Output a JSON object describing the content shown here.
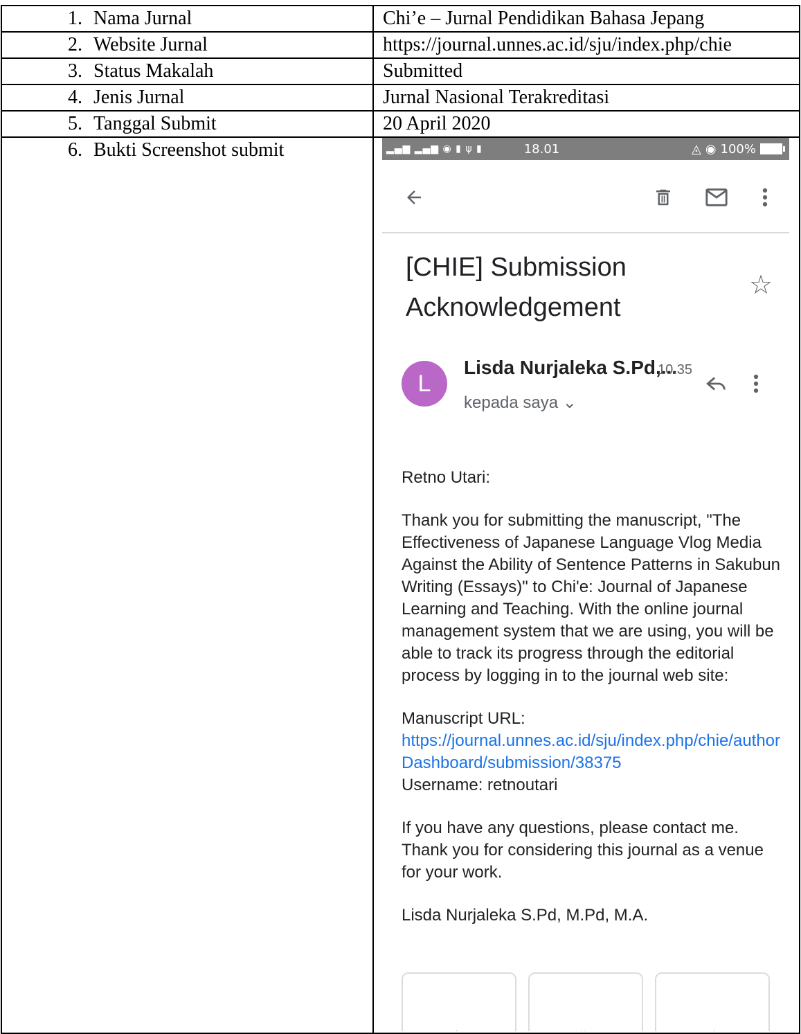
{
  "rows": [
    {
      "num": "1.",
      "label": "Nama Jurnal",
      "value": "Chi’e – Jurnal Pendidikan Bahasa Jepang"
    },
    {
      "num": "2.",
      "label": "Website Jurnal",
      "value": "https://journal.unnes.ac.id/sju/index.php/chie"
    },
    {
      "num": "3.",
      "label": "Status Makalah",
      "value": "Submitted"
    },
    {
      "num": "4.",
      "label": "Jenis Jurnal",
      "value": "Jurnal Nasional Terakreditasi"
    },
    {
      "num": "5.",
      "label": "Tanggal Submit",
      "value": "20 April 2020"
    },
    {
      "num": "6.",
      "label": "Bukti Screenshot submit"
    }
  ],
  "phone": {
    "status": {
      "time": "18.01",
      "battery": "100%"
    },
    "subject": "[CHIE] Submission Acknowledgement",
    "sender": "Lisda Nurjaleka S.Pd,...",
    "sent_time": "10.35",
    "recipient": "kepada saya",
    "avatar_letter": "L",
    "body": {
      "greeting": "Retno Utari:",
      "para1": "Thank you for submitting the manuscript, \"The Effectiveness of Japanese Language Vlog Media Against the Ability of Sentence Patterns in Sakubun Writing (Essays)\" to Chi'e: Journal of Japanese Learning and Teaching. With the online journal management system that we are using, you will be able to track its progress through the editorial process by logging in to the journal web site:",
      "url_label": "Manuscript URL:",
      "url": "https://journal.unnes.ac.id/sju/index.php/chie/authorDashboard/submission/38375",
      "username": "Username: retnoutari",
      "para2": "If you have any questions, please contact me. Thank you for considering this journal as a venue for your work.",
      "signature": "Lisda Nurjaleka S.Pd, M.Pd, M.A."
    },
    "colors": {
      "avatar": "#ba68c8",
      "link": "#1a73e8",
      "status_bar": "#7e7e7e"
    }
  }
}
